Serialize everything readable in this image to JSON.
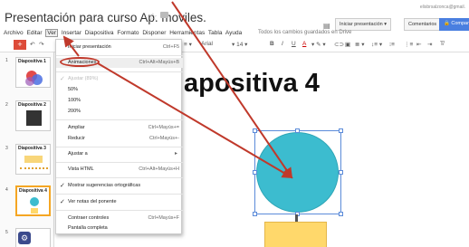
{
  "header": {
    "doc_title": "Presentación para curso Ap. moviles.",
    "user_email": "elisbrsalzonca@gmail.",
    "present_label": "Iniciar presentación",
    "comments_label": "Comentarios",
    "share_label": "Compar"
  },
  "menubar": {
    "items": [
      "Archivo",
      "Editar",
      "Ver",
      "Insertar",
      "Diapositiva",
      "Formato",
      "Disponer",
      "Herramientas",
      "Tabla",
      "Ayuda"
    ],
    "save_status": "Todos los cambios guardados en Drive"
  },
  "toolbar": {
    "new_slide": "+",
    "font": "Arial",
    "font_size": "14",
    "bold": "B",
    "italic": "I",
    "underline": "U",
    "text_color": "A"
  },
  "thumbnails": [
    {
      "number": "1",
      "label": "Diapositiva 1"
    },
    {
      "number": "2",
      "label": "Diapositiva 2"
    },
    {
      "number": "3",
      "label": "Diapositiva 3"
    },
    {
      "number": "4",
      "label": "Diapositiva 4"
    },
    {
      "number": "5",
      "label": ""
    }
  ],
  "slide": {
    "title": "apositiva 4",
    "circle_color": "#3cbccf",
    "rect_color": "#ffd86b"
  },
  "view_menu": {
    "start_presentation": {
      "label": "Iniciar presentación",
      "shortcut": "Ctrl+F5"
    },
    "animations": {
      "label": "Animaciones",
      "shortcut": "Ctrl+Alt+Mayús+B"
    },
    "fit": {
      "label": "Ajustar (89%)"
    },
    "zoom_50": {
      "label": "50%"
    },
    "zoom_100": {
      "label": "100%"
    },
    "zoom_200": {
      "label": "200%"
    },
    "zoom_in": {
      "label": "Ampliar",
      "shortcut": "Ctrl+Mayús+="
    },
    "zoom_out": {
      "label": "Reducir",
      "shortcut": "Ctrl+Mayús+-"
    },
    "fit_to": {
      "label": "Ajustar a"
    },
    "html_view": {
      "label": "Vista HTML",
      "shortcut": "Ctrl+Alt+Mayús+H"
    },
    "spell_suggestions": {
      "label": "Mostrar sugerencias ortográficas",
      "checked": true
    },
    "speaker_notes": {
      "label": "Ver notas del ponente",
      "checked": true
    },
    "compact_controls": {
      "label": "Contraer controles",
      "shortcut": "Ctrl+Mayús+F"
    },
    "fullscreen": {
      "label": "Pantalla completa"
    }
  },
  "annotation_color": "#c0392b"
}
